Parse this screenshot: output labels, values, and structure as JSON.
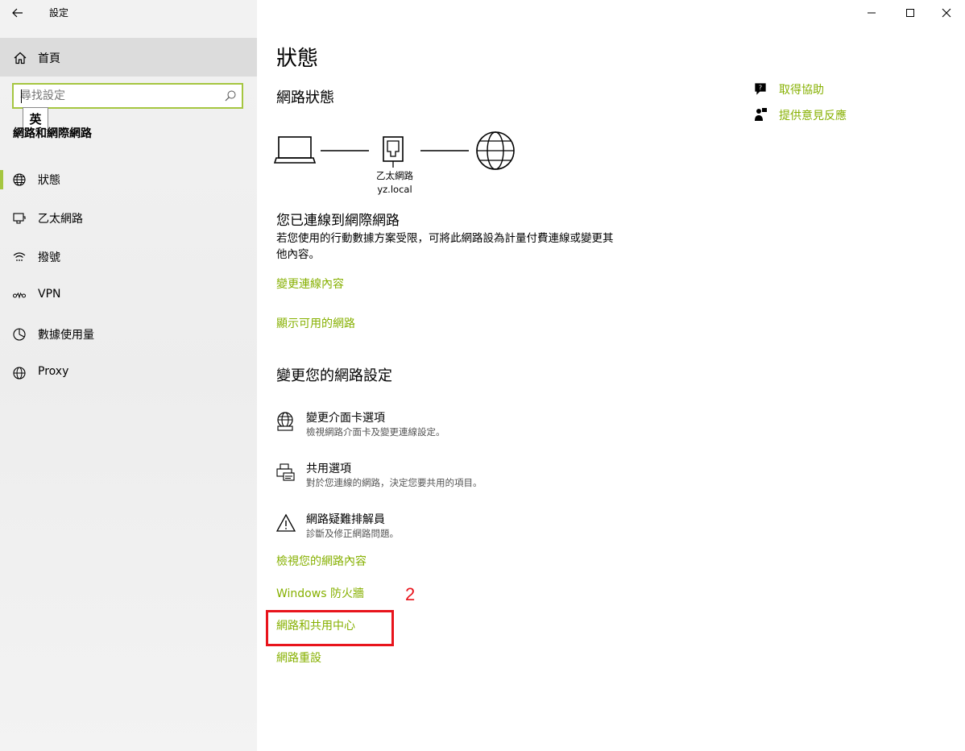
{
  "window": {
    "title": "設定"
  },
  "sidebar": {
    "home_label": "首頁",
    "search_placeholder": "尋找設定",
    "ime_indicator": "英",
    "section_title": "網路和網際網路",
    "items": [
      {
        "label": "狀態",
        "icon": "globe-status-icon",
        "active": true
      },
      {
        "label": "乙太網路",
        "icon": "ethernet-icon"
      },
      {
        "label": "撥號",
        "icon": "dialup-icon"
      },
      {
        "label": "VPN",
        "icon": "vpn-icon"
      },
      {
        "label": "數據使用量",
        "icon": "data-usage-icon"
      },
      {
        "label": "Proxy",
        "icon": "globe-icon"
      }
    ]
  },
  "main": {
    "page_title": "狀態",
    "network_status_heading": "網路狀態",
    "diagram": {
      "adapter_label": "乙太網路",
      "domain_label": "yz.local"
    },
    "connected_heading": "您已連線到網際網路",
    "connected_desc": "若您使用的行動數據方案受限，可將此網路設為計量付費連線或變更其他內容。",
    "links_top": [
      "變更連線內容",
      "顯示可用的網路"
    ],
    "change_settings_heading": "變更您的網路設定",
    "settings_items": [
      {
        "title": "變更介面卡選項",
        "desc": "檢視網路介面卡及變更連線設定。",
        "icon": "adapter-globe-icon"
      },
      {
        "title": "共用選項",
        "desc": "對於您連線的網路，決定您要共用的項目。",
        "icon": "sharing-printer-icon"
      },
      {
        "title": "網路疑難排解員",
        "desc": "診斷及修正網路問題。",
        "icon": "warning-triangle-icon"
      }
    ],
    "links_bottom": [
      "檢視您的網路內容",
      "Windows 防火牆",
      "網路和共用中心",
      "網路重設"
    ]
  },
  "help": {
    "get_help": "取得協助",
    "feedback": "提供意見反應"
  },
  "annotation": {
    "number": "2",
    "color": "#e8141c"
  },
  "colors": {
    "accent": "#86b000",
    "search_border": "#a5c640"
  }
}
